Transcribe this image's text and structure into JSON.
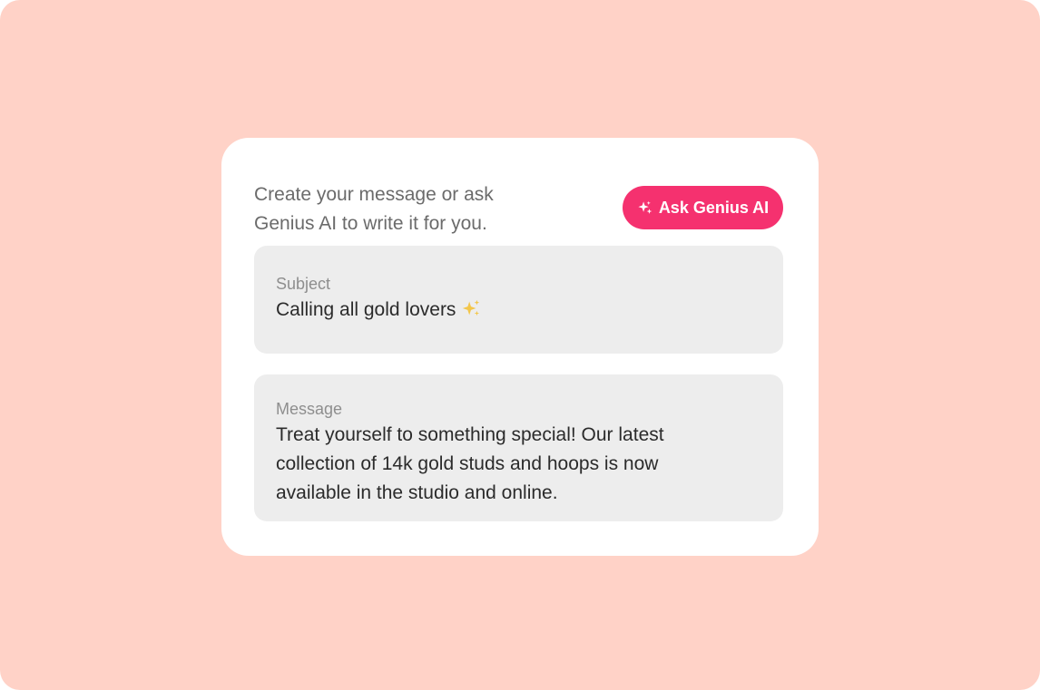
{
  "colors": {
    "backdrop": "#ffd2c7",
    "card": "#ffffff",
    "accent": "#f5316f",
    "field_background": "#ededed",
    "sparkle_emoji": "#f3c64a"
  },
  "composer": {
    "intro_text": "Create your message or ask\nGenius AI to write it for you.",
    "ask_ai_button": {
      "label": "Ask Genius AI",
      "icon": "sparkle-icon"
    },
    "subject": {
      "label": "Subject",
      "value": "Calling all gold lovers",
      "trailing_icon": "sparkles-emoji-icon"
    },
    "message": {
      "label": "Message",
      "value": "Treat yourself to something special! Our latest\ncollection of 14k gold studs and hoops is now\navailable in the studio and online."
    }
  }
}
